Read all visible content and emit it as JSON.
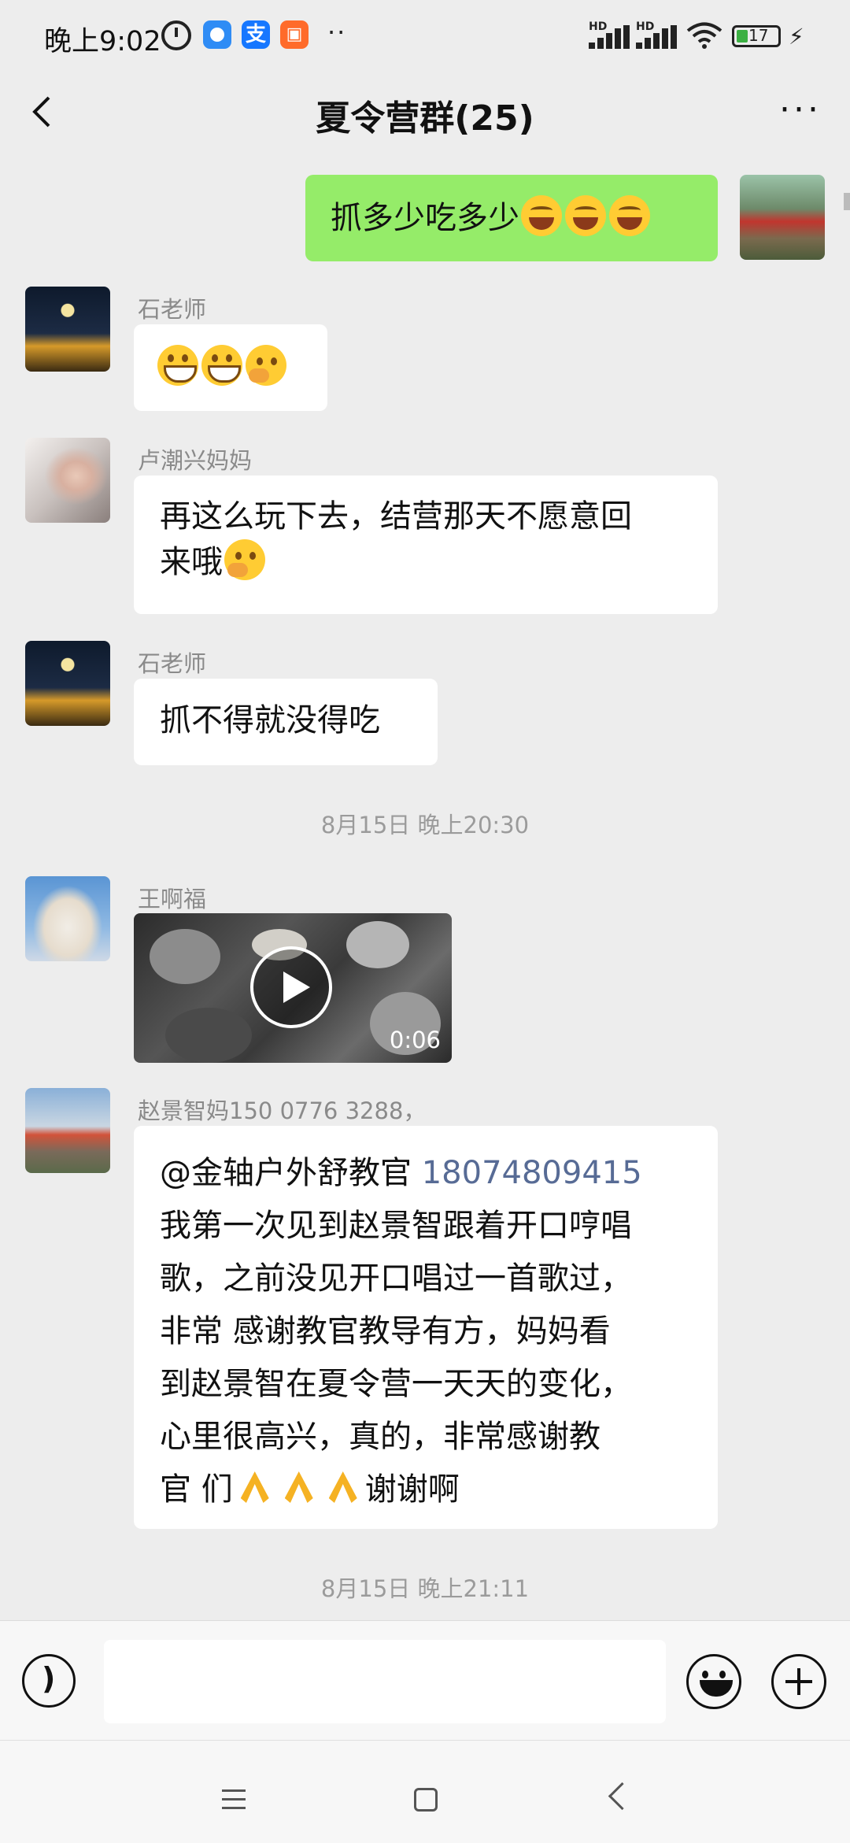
{
  "status_bar": {
    "time": "晚上9:02",
    "alipay": "支",
    "battery": "17",
    "hd1": "HD",
    "hd2": "HD",
    "more_dots": "··"
  },
  "chat": {
    "title": "夏令营群(25)",
    "more": "···"
  },
  "messages": [
    {
      "sender": "",
      "text": "抓多少吃多少",
      "emojis": [
        "laugh-cry",
        "laugh-cry",
        "laugh-cry"
      ],
      "self": true
    },
    {
      "sender": "石老师",
      "text": "",
      "emojis": [
        "grin",
        "grin",
        "thinking"
      ]
    },
    {
      "sender": "卢潮兴妈妈",
      "text_line1": "再这么玩下去，结营那天不愿意回",
      "text_line2": "来哦",
      "emojis": [
        "thinking"
      ]
    },
    {
      "sender": "石老师",
      "text": "抓不得就没得吃"
    },
    {
      "sender": "王啊福",
      "video_duration": "0:06"
    },
    {
      "sender": "赵景智妈150 0776 3288，",
      "mention": "@金轴户外舒教官",
      "phone": "18074809415",
      "lines": [
        "我第一次见到赵景智跟着开口哼唱",
        "歌，之前没见开口唱过一首歌过，",
        "非常 感谢教官教导有方，妈妈看",
        "到赵景智在夏令营一天天的变化，",
        "心里很高兴，真的，非常感谢教"
      ],
      "last_prefix": "官 们",
      "last_suffix": "谢谢啊",
      "emojis": [
        "pray",
        "pray",
        "pray"
      ]
    }
  ],
  "timestamps": [
    "8月15日 晚上20:30",
    "8月15日 晚上21:11"
  ],
  "input": {
    "placeholder": ""
  }
}
